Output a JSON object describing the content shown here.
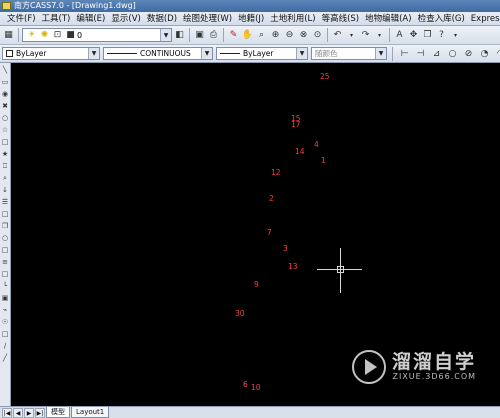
{
  "window": {
    "title": "南方CASS7.0 - [Drawing1.dwg]"
  },
  "menu": {
    "items": [
      "文件(F)",
      "工具(T)",
      "编辑(E)",
      "显示(V)",
      "数据(D)",
      "绘图处理(W)",
      "地籍(J)",
      "土地利用(L)",
      "等高线(S)",
      "地物编辑(A)",
      "检查入库(G)",
      "Express"
    ]
  },
  "toolbar": {
    "layer_value": "0",
    "icons": [
      "light-bulb-icon",
      "sun-icon",
      "lock-icon",
      "color-square-icon",
      "layer-dropdown",
      "layers-icon",
      "save-icon",
      "pencil-icon",
      "zoom-realtime-icon",
      "zoom-window-icon",
      "zoom-previous-icon",
      "pan-icon",
      "undo-icon",
      "redo-icon",
      "text-icon",
      "dimension-icon",
      "circle-icon",
      "no-icon",
      "help-icon"
    ]
  },
  "properties": {
    "color": "ByLayer",
    "linetype": "CONTINUOUS",
    "lineweight": "ByLayer",
    "plotstyle": "随颜色"
  },
  "left_toolbar": {
    "glyphs": [
      "╲",
      "▭",
      "◉",
      "✖",
      "○",
      "☆",
      "□",
      "★",
      "⎕",
      "⌕",
      "↓",
      "☰",
      "□",
      "❐",
      "○",
      "□",
      "≡",
      "□",
      "└",
      "▣",
      "⌁",
      "☉",
      "□",
      "∕",
      "╱"
    ]
  },
  "drawing": {
    "point_labels": [
      "25",
      "15",
      "17",
      "4",
      "14",
      "1",
      "12",
      "2",
      "7",
      "3",
      "13",
      "9",
      "30",
      "6",
      "10"
    ],
    "label_color": "#ff3b3b"
  },
  "tabs": {
    "model": "模型",
    "layout1": "Layout1"
  },
  "watermark": {
    "title": "溜溜自学",
    "url": "ZIXUE.3D66.COM"
  }
}
